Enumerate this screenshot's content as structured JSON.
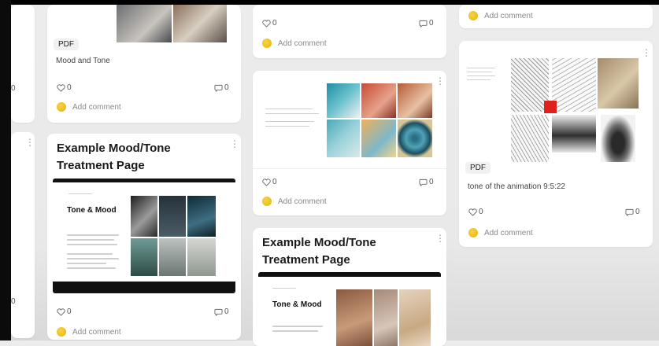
{
  "cards": {
    "c1": {
      "badge": "PDF",
      "caption": "Mood and Tone",
      "likes": "0",
      "comments": "0",
      "add_comment": "Add comment"
    },
    "c2": {
      "likes": "0",
      "comments": "0",
      "add_comment": "Add comment"
    },
    "c3": {
      "likes": "0",
      "comments": "0",
      "add_comment": "Add comment"
    },
    "c4": {
      "title_line1": "Example Mood/Tone",
      "title_line2": "Treatment Page",
      "page_heading": "Tone & Mood",
      "likes": "0",
      "comments": "0",
      "add_comment": "Add comment"
    },
    "c5": {
      "title_line1": "Example Mood/Tone",
      "title_line2": "Treatment Page",
      "page_heading": "Tone & Mood"
    },
    "c6": {
      "add_comment": "Add comment"
    },
    "c7": {
      "badge": "PDF",
      "caption": "tone of the animation 9:5:22",
      "likes": "0",
      "comments": "0",
      "add_comment": "Add comment"
    },
    "edge": {
      "count_top": "0",
      "count_bottom": "0"
    }
  },
  "colors": {
    "accent_red": "#e0201c",
    "avatar_yellow": "#f2c21b"
  },
  "icons": {
    "like": "heart-icon",
    "comment": "comment-bubble-icon",
    "more": "kebab-menu-icon"
  }
}
